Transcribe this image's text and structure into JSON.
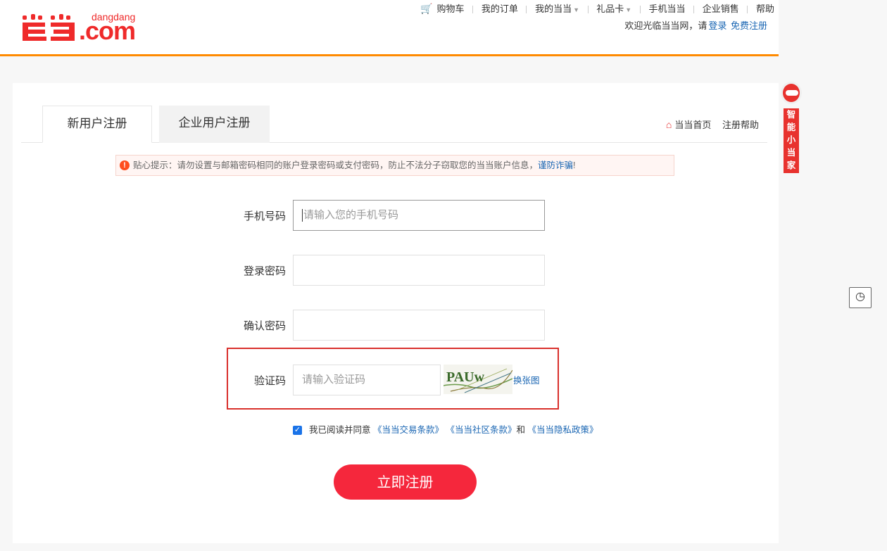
{
  "logo": {
    "text": "dangdang",
    "domain": ".com"
  },
  "topnav": {
    "cart": "购物车",
    "orders": "我的订单",
    "my_dangdang": "我的当当",
    "gift_card": "礼品卡",
    "mobile": "手机当当",
    "enterprise": "企业销售",
    "help": "帮助"
  },
  "welcome": {
    "text": "欢迎光临当当网，请",
    "login": "登录",
    "register": "免费注册"
  },
  "tabs": [
    {
      "label": "新用户注册"
    },
    {
      "label": "企业用户注册"
    }
  ],
  "right_links": {
    "home": "当当首页",
    "help": "注册帮助"
  },
  "notice": {
    "text": "贴心提示：请勿设置与邮箱密码相同的账户登录密码或支付密码，防止不法分子窃取您的当当账户信息，",
    "link": "谨防诈骗",
    "end": "!"
  },
  "form": {
    "phone_label": "手机号码",
    "phone_placeholder": "请输入您的手机号码",
    "password_label": "登录密码",
    "confirm_label": "确认密码",
    "captcha_label": "验证码",
    "captcha_placeholder": "请输入验证码",
    "captcha_text": "PAUw",
    "captcha_refresh": "换张图"
  },
  "agreement": {
    "text": "我已阅读并同意",
    "terms1": "《当当交易条款》",
    "terms2": "《当当社区条款》",
    "and": "和",
    "terms3": "《当当隐私政策》",
    "checked": true
  },
  "submit": "立即注册",
  "assistant": {
    "label": "智能小当家"
  },
  "colors": {
    "accent": "#ff8a00",
    "brand_red": "#ef2a2a",
    "button_red": "#f5273c",
    "link": "#1a66b3"
  }
}
